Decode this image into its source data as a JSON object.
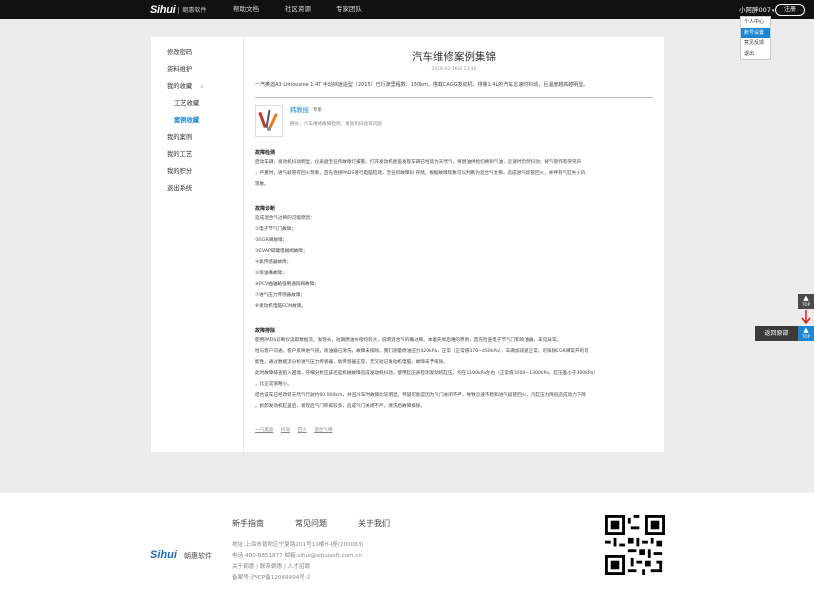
{
  "header": {
    "logo_text": "Sihui",
    "logo_sub": "朝惠软件",
    "nav": [
      "帮助文档",
      "社区资源",
      "专家团队"
    ],
    "user_name": "小阿胖007",
    "register_label": "注册",
    "dropdown": [
      "个人中心",
      "账号设置",
      "意见反馈",
      "退出"
    ]
  },
  "sidebar": {
    "items": [
      "修改密码",
      "资料维护",
      "我的收藏",
      "工艺收藏",
      "案例收藏",
      "我的案例",
      "我的工艺",
      "我的积分",
      "退出系统"
    ]
  },
  "article": {
    "title": "汽车维修案例集锦",
    "date": "2016-02-16日 13:46",
    "intro": "一汽奥迪A3 Limousine 1.4T 手动挡逍遥型（2015）已行驶里程数：150km。搭载CAGG发动机，排量1.4L的汽车怠速时抖动，且温度越高越明显。",
    "author": {
      "name": "韩教授",
      "role": "专家",
      "skill": "擅长：汽车维修故障检修，发动机抖动等问题"
    },
    "sections": [
      {
        "title": "故障检测",
        "lines": [
          "启动车辆，发动机抖动明显，仪表盘无任何故障灯报警。打开发动机舱盖发现车辆已经装为天然气，将燃油供给切换到气油，怠速时仍然抖动；将气管作有突突声",
          "，严重时，进气岐管有回火现象，首先连接PADS进行电脑检测，无任何故障码 存储，根据故障现象可以判断为混合气太稀，造成进气歧管回火，并伴有气缸失火的",
          "现象。"
        ]
      },
      {
        "title": "故障诊断",
        "lines": [
          "造成混合气过稀的可能原因：",
          "①电子节气门故障；",
          "②EGR阀故障；",
          "③EVAP碳罐电磁阀故障；",
          "④氧传感器故障；",
          "⑤喷油嘴故障；",
          "⑥PCV曲轴箱强制通风阀故障；",
          "⑦进气压力传感器故障；",
          "⑧发动机电脑ECM故障。"
        ]
      },
      {
        "title": "故障排除",
        "lines": [
          "使用PADS诊断仪读取数据流，发现长，短期燃油补偿均较大，说明混合气的确过稀。本着先易后难的原则，首先检查电子节气门和喷油器，未见异常。",
          "经与客户沟通，客户反映进气道，喷油器已清洗，故障未排除。我们测量燃油压力420kPa，正常（正常值370~450kPa），车辆加减速正常，可排除EGR阀常开的可",
          "能性，通过数据流分析进气压力传感器，氧传感器正常，无叉短记发动机电脑，故障未予排除。",
          "此时故障排查陷入困境，仔细分析应该还是机械故障造成发动机抖动，使用缸压表检测发动机缸压，均在1100kPa左右（正常值1000~1300kPa，缸压差小于300kPa）",
          "，比正常值略小。",
          "结合该车已经改装天然气行驶约60,000km，并且冷车时故障比较明显，怀疑可能是因为气门关闭不严，导致怠速不稳和进气岐管回火，汽缸压力降低造成动力下降",
          "。拆卸发动机缸盖后，发现后气门积碳较多，造成气门关闭不严。清洗后故障排除。"
        ]
      }
    ],
    "tags": [
      "一汽奥迪",
      "抖动",
      "回火",
      "混合气稀"
    ]
  },
  "float_panel": {
    "top_label": "TOP",
    "back_label": "返回原部",
    "accent": "#1b87d2"
  },
  "footer": {
    "links": [
      "新手指南",
      "常见问题",
      "关于我们"
    ],
    "info": [
      "地址:上海市普陀区宁夏路201号13楼H-I座(200063)",
      "电话:400-8851877 邮箱:sihui@sihuisoft.com.cn",
      "关于朝惠 | 联系朝惠 | 人才招聘",
      "备案号:沪ICP备12049494号-2"
    ],
    "logo_text": "Sihui",
    "logo_cn": "朝惠软件"
  }
}
